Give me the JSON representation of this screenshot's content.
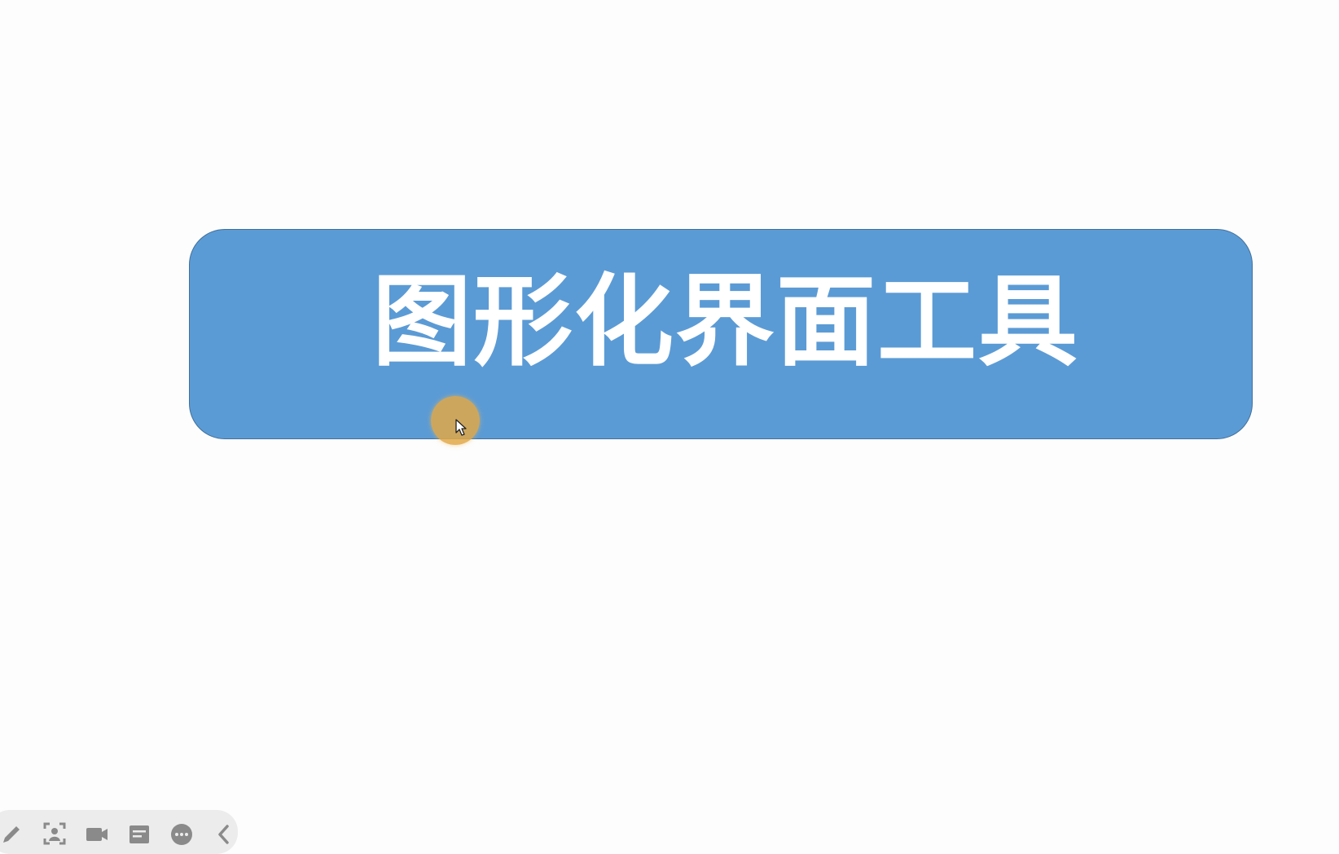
{
  "slide": {
    "title": "图形化界面工具",
    "box_color": "#5b9bd5",
    "text_color": "#ffffff"
  },
  "cursor": {
    "highlight_color": "#e2a848"
  },
  "toolbar": {
    "icons": [
      "pen-icon",
      "screenshot-icon",
      "camera-icon",
      "notes-icon",
      "more-icon",
      "collapse-icon"
    ]
  }
}
